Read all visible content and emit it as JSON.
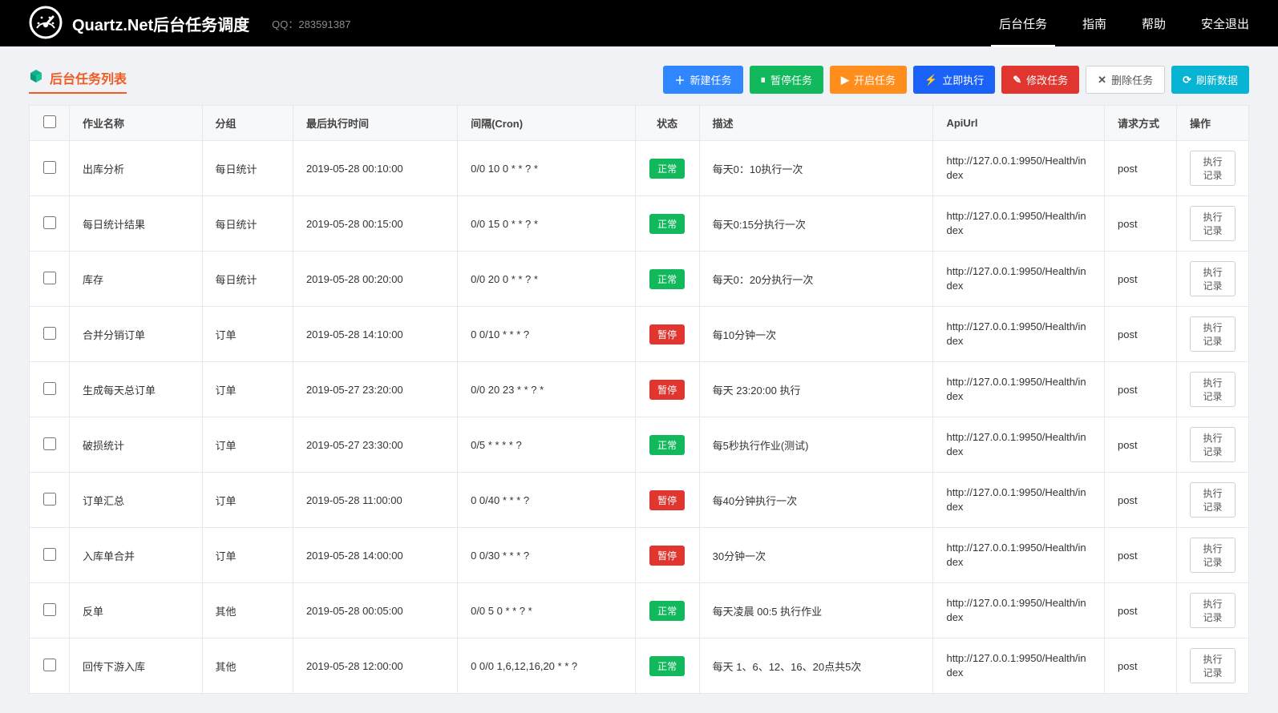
{
  "header": {
    "title": "Quartz.Net后台任务调度",
    "qq": "QQ：283591387",
    "nav": [
      "后台任务",
      "指南",
      "帮助",
      "安全退出"
    ],
    "active_index": 0
  },
  "panel": {
    "title": "后台任务列表"
  },
  "buttons": {
    "new": "新建任务",
    "pause": "暂停任务",
    "start": "开启任务",
    "run": "立即执行",
    "modify": "修改任务",
    "delete": "删除任务",
    "refresh": "刷新数据"
  },
  "columns": {
    "check": "",
    "name": "作业名称",
    "group": "分组",
    "last": "最后执行时间",
    "cron": "间隔(Cron)",
    "status": "状态",
    "desc": "描述",
    "api": "ApiUrl",
    "method": "请求方式",
    "op": "操作"
  },
  "status_labels": {
    "ok": "正常",
    "pause": "暂停"
  },
  "row_action_label": "执行记录",
  "rows": [
    {
      "name": "出库分析",
      "group": "每日统计",
      "last": "2019-05-28 00:10:00",
      "cron": "0/0 10 0 * * ? *",
      "status": "ok",
      "desc": "每天0：10执行一次",
      "api": "http://127.0.0.1:9950/Health/index",
      "method": "post"
    },
    {
      "name": "每日统计结果",
      "group": "每日统计",
      "last": "2019-05-28 00:15:00",
      "cron": "0/0 15 0 * * ? *",
      "status": "ok",
      "desc": "每天0:15分执行一次",
      "api": "http://127.0.0.1:9950/Health/index",
      "method": "post"
    },
    {
      "name": "库存",
      "group": "每日统计",
      "last": "2019-05-28 00:20:00",
      "cron": "0/0 20 0 * * ? *",
      "status": "ok",
      "desc": "每天0：20分执行一次",
      "api": "http://127.0.0.1:9950/Health/index",
      "method": "post"
    },
    {
      "name": "合并分销订单",
      "group": "订单",
      "last": "2019-05-28 14:10:00",
      "cron": "0 0/10 * * * ?",
      "status": "pause",
      "desc": "每10分钟一次",
      "api": "http://127.0.0.1:9950/Health/index",
      "method": "post"
    },
    {
      "name": "生成每天总订单",
      "group": "订单",
      "last": "2019-05-27 23:20:00",
      "cron": "0/0 20 23 * * ? *",
      "status": "pause",
      "desc": "每天 23:20:00 执行",
      "api": "http://127.0.0.1:9950/Health/index",
      "method": "post"
    },
    {
      "name": "破损统计",
      "group": "订单",
      "last": "2019-05-27 23:30:00",
      "cron": "0/5 * * * * ?",
      "status": "ok",
      "desc": "每5秒执行作业(测试)",
      "api": "http://127.0.0.1:9950/Health/index",
      "method": "post"
    },
    {
      "name": "订单汇总",
      "group": "订单",
      "last": "2019-05-28 11:00:00",
      "cron": "0 0/40 * * * ?",
      "status": "pause",
      "desc": "每40分钟执行一次",
      "api": "http://127.0.0.1:9950/Health/index",
      "method": "post"
    },
    {
      "name": "入库单合并",
      "group": "订单",
      "last": "2019-05-28 14:00:00",
      "cron": "0 0/30 * * * ?",
      "status": "pause",
      "desc": "30分钟一次",
      "api": "http://127.0.0.1:9950/Health/index",
      "method": "post"
    },
    {
      "name": "反单",
      "group": "其他",
      "last": "2019-05-28 00:05:00",
      "cron": "0/0 5 0 * * ? *",
      "status": "ok",
      "desc": "每天凌晨 00:5 执行作业",
      "api": "http://127.0.0.1:9950/Health/index",
      "method": "post"
    },
    {
      "name": "回传下游入库",
      "group": "其他",
      "last": "2019-05-28 12:00:00",
      "cron": "0 0/0 1,6,12,16,20 * * ?",
      "status": "ok",
      "desc": "每天 1、6、12、16、20点共5次",
      "api": "http://127.0.0.1:9950/Health/index",
      "method": "post"
    }
  ]
}
